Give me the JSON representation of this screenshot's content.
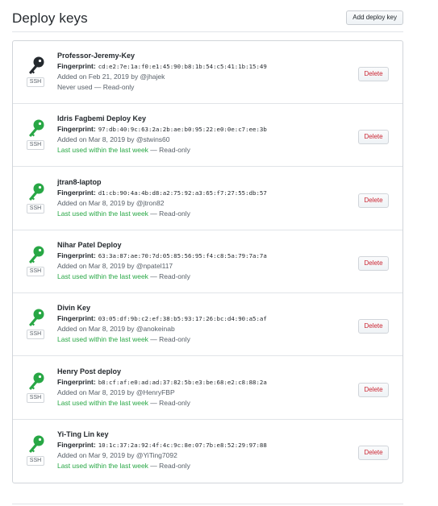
{
  "header": {
    "title": "Deploy keys",
    "add_button_label": "Add deploy key"
  },
  "colors": {
    "key_unused": "#24292e",
    "key_used": "#28a745",
    "delete_text": "#cb2431"
  },
  "keys": [
    {
      "title": "Professor-Jeremy-Key",
      "fingerprint_label": "Fingerprint:",
      "fingerprint": "cd:e2:7e:1a:f0:e1:45:90:b8:1b:54:c5:41:1b:15:49",
      "added": "Added on Feb 21, 2019 by @jhajek",
      "usage": "Never used",
      "access": " — Read-only",
      "badge": "SSH",
      "delete_label": "Delete",
      "used": false
    },
    {
      "title": "Idris Fagbemi Deploy Key",
      "fingerprint_label": "Fingerprint:",
      "fingerprint": "97:db:40:9c:63:2a:2b:ae:b0:95:22:e0:0e:c7:ee:3b",
      "added": "Added on Mar 8, 2019 by @stwins60",
      "usage": "Last used within the last week",
      "access": " — Read-only",
      "badge": "SSH",
      "delete_label": "Delete",
      "used": true
    },
    {
      "title": "jtran8-laptop",
      "fingerprint_label": "Fingerprint:",
      "fingerprint": "d1:cb:90:4a:4b:d8:a2:75:92:a3:65:f7:27:55:db:57",
      "added": "Added on Mar 8, 2019 by @jtron82",
      "usage": "Last used within the last week",
      "access": " — Read-only",
      "badge": "SSH",
      "delete_label": "Delete",
      "used": true
    },
    {
      "title": "Nihar Patel Deploy",
      "fingerprint_label": "Fingerprint:",
      "fingerprint": "63:3a:87:ae:70:7d:05:85:56:95:f4:c8:5a:79:7a:7a",
      "added": "Added on Mar 8, 2019 by @npatel117",
      "usage": "Last used within the last week",
      "access": " — Read-only",
      "badge": "SSH",
      "delete_label": "Delete",
      "used": true
    },
    {
      "title": "Divin Key",
      "fingerprint_label": "Fingerprint:",
      "fingerprint": "03:05:df:9b:c2:ef:38:b5:93:17:26:bc:d4:90:a5:af",
      "added": "Added on Mar 8, 2019 by @anokeinab",
      "usage": "Last used within the last week",
      "access": " — Read-only",
      "badge": "SSH",
      "delete_label": "Delete",
      "used": true
    },
    {
      "title": "Henry Post deploy",
      "fingerprint_label": "Fingerprint:",
      "fingerprint": "b8:cf:af:e0:ad:ad:37:82:5b:e3:be:68:e2:c8:88:2a",
      "added": "Added on Mar 8, 2019 by @HenryFBP",
      "usage": "Last used within the last week",
      "access": " — Read-only",
      "badge": "SSH",
      "delete_label": "Delete",
      "used": true
    },
    {
      "title": "Yi-Ting Lin key",
      "fingerprint_label": "Fingerprint:",
      "fingerprint": "10:1c:37:2a:92:4f:4c:9c:8e:07:7b:e8:52:29:97:88",
      "added": "Added on Mar 9, 2019 by @YiTing7092",
      "usage": "Last used within the last week",
      "access": " — Read-only",
      "badge": "SSH",
      "delete_label": "Delete",
      "used": true
    }
  ]
}
